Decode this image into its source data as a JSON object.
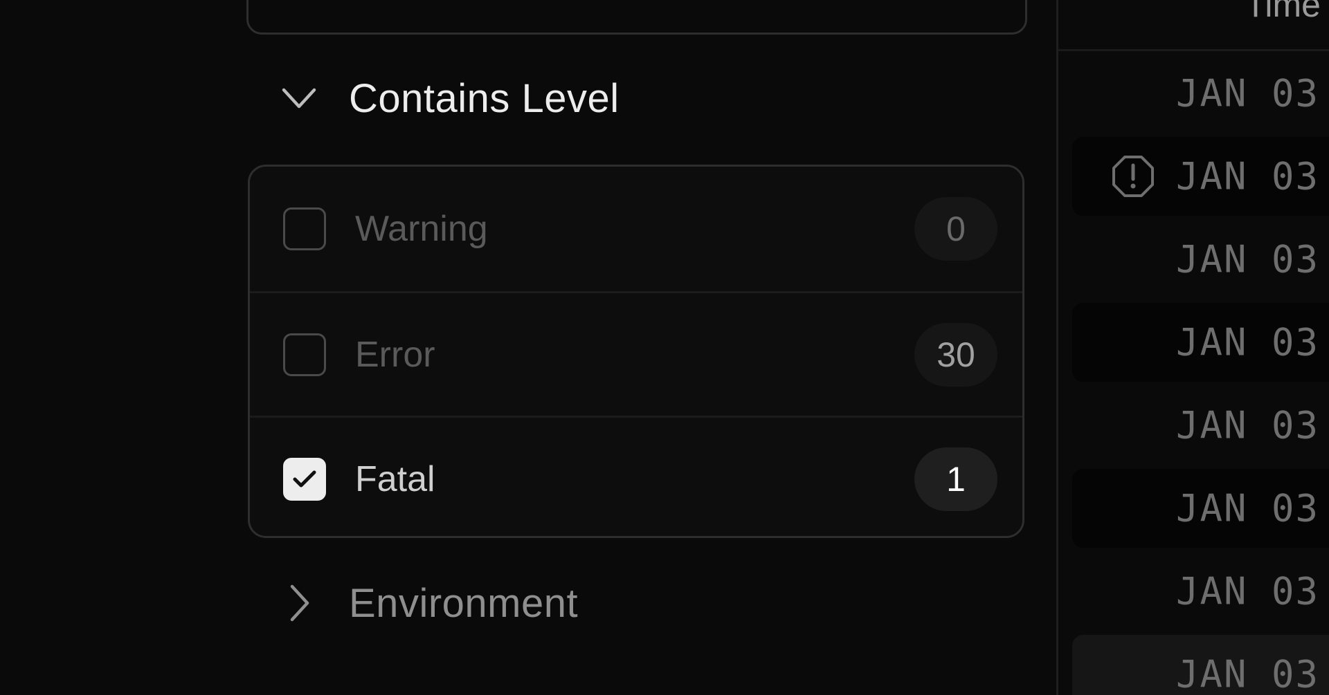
{
  "filters": {
    "contains_level": {
      "title": "Contains Level",
      "expanded": true,
      "levels": [
        {
          "label": "Warning",
          "count": "0",
          "checked": false
        },
        {
          "label": "Error",
          "count": "30",
          "checked": false
        },
        {
          "label": "Fatal",
          "count": "1",
          "checked": true
        }
      ]
    },
    "environment": {
      "title": "Environment",
      "expanded": false
    }
  },
  "timeline": {
    "header": "Time",
    "rows": [
      {
        "date": "JAN 03",
        "warning": false,
        "style": "plain"
      },
      {
        "date": "JAN 03",
        "warning": true,
        "style": "dark"
      },
      {
        "date": "JAN 03",
        "warning": false,
        "style": "plain"
      },
      {
        "date": "JAN 03",
        "warning": false,
        "style": "dark"
      },
      {
        "date": "JAN 03",
        "warning": false,
        "style": "plain"
      },
      {
        "date": "JAN 03",
        "warning": false,
        "style": "dark"
      },
      {
        "date": "JAN 03",
        "warning": false,
        "style": "plain"
      },
      {
        "date": "JAN 03",
        "warning": false,
        "style": "hl"
      }
    ]
  },
  "colors": {
    "background": "#0a0a0a",
    "border": "#2e2e2e",
    "checked_fill": "#ededed"
  }
}
